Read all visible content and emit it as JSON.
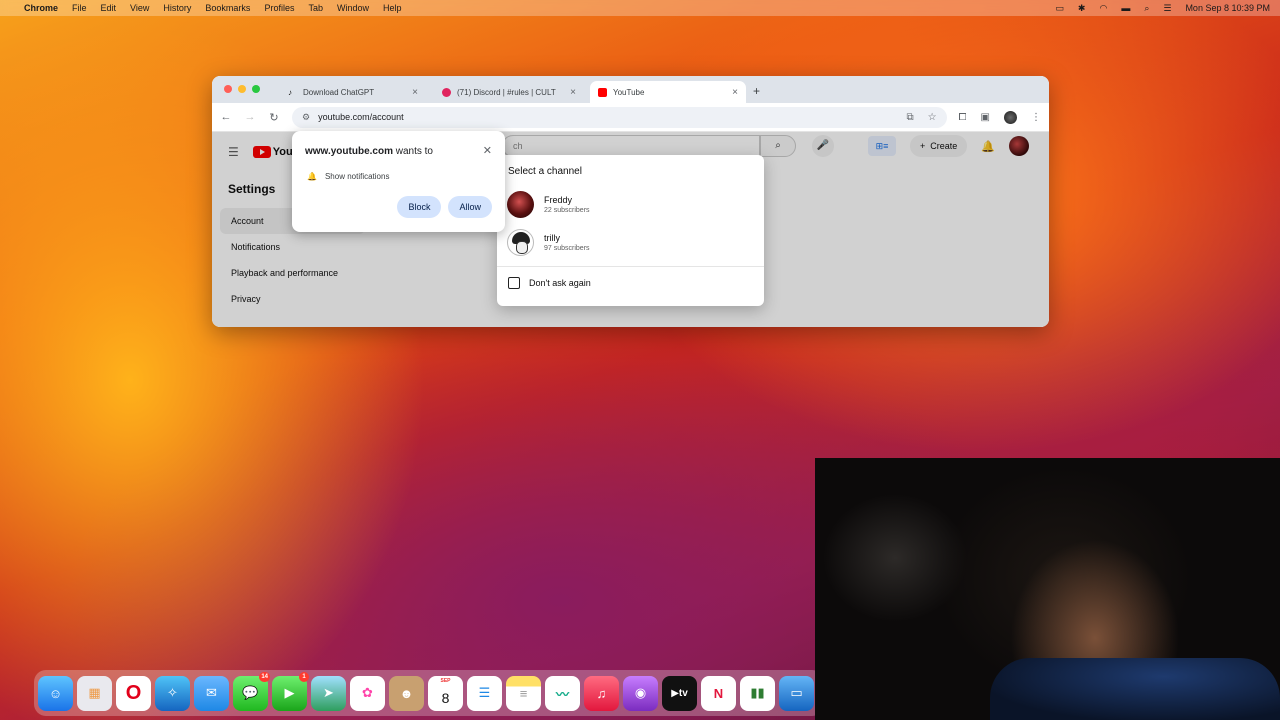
{
  "menubar": {
    "app": "Chrome",
    "menus": [
      "File",
      "Edit",
      "View",
      "History",
      "Bookmarks",
      "Profiles",
      "Tab",
      "Window",
      "Help"
    ],
    "clock": "Mon Sep 8  10:39 PM"
  },
  "browser": {
    "tabs": [
      {
        "title": "Download ChatGPT",
        "favicon_color": "#111111"
      },
      {
        "title": "(71) Discord | #rules | CULT",
        "favicon_color": "#e0245e"
      },
      {
        "title": "YouTube",
        "favicon_color": "#ff0000"
      }
    ],
    "url": "youtube.com/account"
  },
  "youtube": {
    "logo": "You",
    "search_placeholder": "ch",
    "create_label": "Create",
    "settings_title": "Settings",
    "side_items": [
      "Account",
      "Notifications",
      "Playback and performance",
      "Privacy"
    ]
  },
  "permission": {
    "site": "www.youtube.com",
    "wants_to": " wants to",
    "row_label": "Show notifications",
    "block_label": "Block",
    "allow_label": "Allow"
  },
  "channel_selector": {
    "title": "Select a channel",
    "channels": [
      {
        "name": "Freddy",
        "subs": "22 subscribers"
      },
      {
        "name": "trilly",
        "subs": "97 subscribers"
      }
    ],
    "dont_ask_label": "Don't ask again"
  },
  "dock": {
    "messages_badge": "14",
    "facetime_badge": "1",
    "calendar_month": "SEP",
    "calendar_day": "8"
  }
}
